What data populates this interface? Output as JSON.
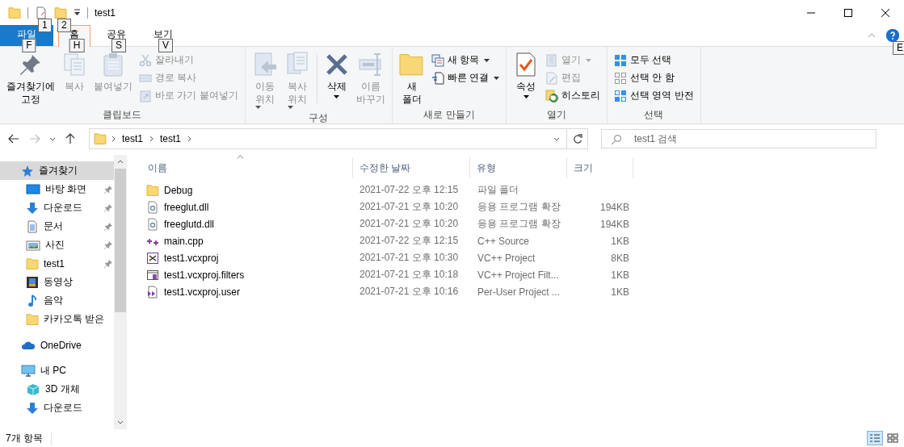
{
  "window": {
    "title": "test1",
    "quick_access_tips": [
      "1",
      "2"
    ]
  },
  "ribbon": {
    "help_key_tip": "E",
    "tabs": [
      {
        "label": "파일",
        "kind": "file",
        "selected": false,
        "key_tip": "F"
      },
      {
        "label": "홈",
        "kind": "tab",
        "selected": true,
        "key_tip": "H"
      },
      {
        "label": "공유",
        "kind": "tab",
        "selected": false,
        "key_tip": "S"
      },
      {
        "label": "보기",
        "kind": "tab",
        "selected": false,
        "key_tip": "V"
      }
    ],
    "groups": [
      {
        "label": "클립보드",
        "items": [
          {
            "kind": "large",
            "label": "즐겨찾기에\n고정",
            "disabled": false,
            "dropdown": false
          },
          {
            "kind": "large",
            "label": "복사",
            "disabled": true,
            "dropdown": false
          },
          {
            "kind": "large",
            "label": "붙여넣기",
            "disabled": true,
            "dropdown": false
          },
          {
            "kind": "stack",
            "items": [
              {
                "label": "잘라내기",
                "disabled": true,
                "dropdown": false
              },
              {
                "label": "경로 복사",
                "disabled": true,
                "dropdown": false
              },
              {
                "label": "바로 가기 붙여넣기",
                "disabled": true,
                "dropdown": false
              }
            ]
          }
        ]
      },
      {
        "label": "구성",
        "items": [
          {
            "kind": "large",
            "label": "이동\n위치",
            "disabled": true,
            "dropdown": true
          },
          {
            "kind": "large",
            "label": "복사\n위치",
            "disabled": true,
            "dropdown": true
          },
          {
            "kind": "separator"
          },
          {
            "kind": "large",
            "label": "삭제",
            "disabled": false,
            "dropdown": true
          },
          {
            "kind": "large",
            "label": "이름\n바꾸기",
            "disabled": true,
            "dropdown": false
          }
        ]
      },
      {
        "label": "새로 만들기",
        "items": [
          {
            "kind": "large",
            "label": "새\n폴더",
            "disabled": false,
            "dropdown": false
          },
          {
            "kind": "stack",
            "items": [
              {
                "label": "새 항목",
                "disabled": false,
                "dropdown": true
              },
              {
                "label": "빠른 연결",
                "disabled": false,
                "dropdown": true
              }
            ]
          }
        ]
      },
      {
        "label": "열기",
        "items": [
          {
            "kind": "large",
            "label": "속성",
            "disabled": false,
            "dropdown": true
          },
          {
            "kind": "stack",
            "items": [
              {
                "label": "열기",
                "disabled": true,
                "dropdown": true
              },
              {
                "label": "편집",
                "disabled": true,
                "dropdown": false
              },
              {
                "label": "히스토리",
                "disabled": false,
                "dropdown": false
              }
            ]
          }
        ]
      },
      {
        "label": "선택",
        "items": [
          {
            "kind": "stack",
            "items": [
              {
                "label": "모두 선택",
                "disabled": false,
                "dropdown": false
              },
              {
                "label": "선택 안 함",
                "disabled": false,
                "dropdown": false
              },
              {
                "label": "선택 영역 반전",
                "disabled": false,
                "dropdown": false
              }
            ]
          }
        ]
      }
    ]
  },
  "navigation": {
    "back_disabled": false,
    "forward_disabled": true,
    "breadcrumb": [
      "test1",
      "test1"
    ],
    "search": {
      "placeholder": "test1 검색"
    }
  },
  "sidebar": {
    "items": [
      {
        "label": "즐겨찾기",
        "kind": "star",
        "selected": true,
        "pinned": false,
        "children": [
          {
            "label": "바탕 화면",
            "kind": "desktop",
            "selected": false,
            "pinned": true
          },
          {
            "label": "다운로드",
            "kind": "download",
            "selected": false,
            "pinned": true
          },
          {
            "label": "문서",
            "kind": "document",
            "selected": false,
            "pinned": true
          },
          {
            "label": "사진",
            "kind": "image",
            "selected": false,
            "pinned": true
          },
          {
            "label": "test1",
            "kind": "folder",
            "selected": false,
            "pinned": true
          },
          {
            "label": "동영상",
            "kind": "video",
            "selected": false,
            "pinned": false
          },
          {
            "label": "음악",
            "kind": "music",
            "selected": false,
            "pinned": false
          },
          {
            "label": "카카오톡 받은",
            "kind": "folder",
            "selected": false,
            "pinned": false
          }
        ]
      },
      {
        "label": "OneDrive",
        "kind": "cloud",
        "selected": false,
        "pinned": false
      },
      {
        "label": "내 PC",
        "kind": "pc",
        "selected": false,
        "pinned": false,
        "children": [
          {
            "label": "3D 개체",
            "kind": "cube",
            "selected": false,
            "pinned": false
          },
          {
            "label": "다운로드",
            "kind": "download",
            "selected": false,
            "pinned": false
          }
        ]
      }
    ]
  },
  "file_list": {
    "columns": [
      {
        "label": "이름",
        "sorted": true
      },
      {
        "label": "수정한 날짜",
        "sorted": false
      },
      {
        "label": "유형",
        "sorted": false
      },
      {
        "label": "크기",
        "sorted": false
      }
    ],
    "rows": [
      {
        "kind": "folder",
        "name": "Debug",
        "modified": "2021-07-22 오후 12:15",
        "type": "파일 폴더"
      },
      {
        "kind": "dll",
        "name": "freeglut.dll",
        "modified": "2021-07-21 오후 10:20",
        "type": "응용 프로그램 확장",
        "size": "194KB"
      },
      {
        "kind": "dll",
        "name": "freeglutd.dll",
        "modified": "2021-07-21 오후 10:20",
        "type": "응용 프로그램 확장",
        "size": "194KB"
      },
      {
        "kind": "cpp",
        "name": "main.cpp",
        "modified": "2021-07-22 오후 12:15",
        "type": "C++ Source",
        "size": "1KB"
      },
      {
        "kind": "project",
        "name": "test1.vcxproj",
        "modified": "2021-07-21 오후 10:30",
        "type": "VC++ Project",
        "size": "8KB"
      },
      {
        "kind": "filters",
        "name": "test1.vcxproj.filters",
        "modified": "2021-07-21 오후 10:18",
        "type": "VC++ Project Filt...",
        "size": "1KB"
      },
      {
        "kind": "user",
        "name": "test1.vcxproj.user",
        "modified": "2021-07-21 오후 10:16",
        "type": "Per-User Project ...",
        "size": "1KB"
      }
    ]
  },
  "status_bar": {
    "item_count": "7개 항목",
    "views": [
      {
        "kind": "details",
        "selected": true
      },
      {
        "kind": "tiles",
        "selected": false
      }
    ]
  }
}
